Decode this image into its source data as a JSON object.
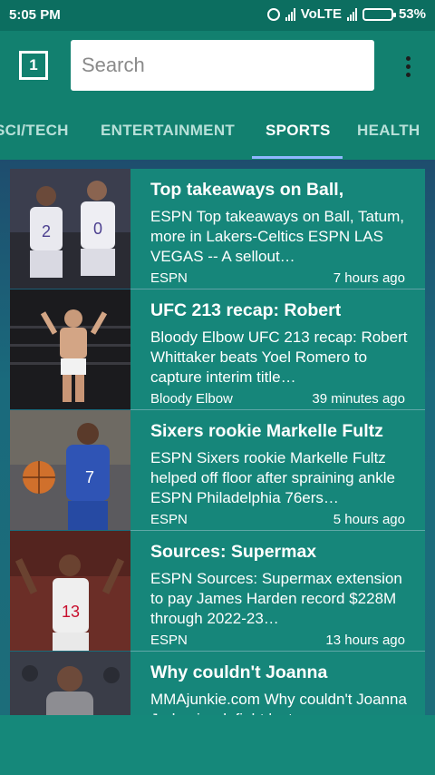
{
  "status_bar": {
    "time": "5:05 PM",
    "network": "VoLTE",
    "battery_percent": "53%",
    "battery_level": 0.53
  },
  "toolbar": {
    "tab_count": "1",
    "search_placeholder": "Search"
  },
  "tabs": [
    {
      "label": "SCI/TECH",
      "active": false
    },
    {
      "label": "ENTERTAINMENT",
      "active": false
    },
    {
      "label": "SPORTS",
      "active": true
    },
    {
      "label": "HEALTH",
      "active": false
    }
  ],
  "articles": [
    {
      "title": "Top takeaways on Ball,",
      "snippet": "ESPN Top takeaways on Ball, Tatum, more in Lakers-Celtics ESPN LAS VEGAS -- A sellout…",
      "source": "ESPN",
      "time": "7 hours ago"
    },
    {
      "title": "UFC 213 recap: Robert",
      "snippet": "Bloody Elbow UFC 213 recap: Robert Whittaker beats Yoel Romero to capture interim title…",
      "source": "Bloody Elbow",
      "time": "39 minutes ago"
    },
    {
      "title": "Sixers rookie Markelle Fultz",
      "snippet": "ESPN Sixers rookie Markelle Fultz helped off floor after spraining ankle ESPN Philadelphia 76ers…",
      "source": "ESPN",
      "time": "5 hours ago"
    },
    {
      "title": "Sources: Supermax",
      "snippet": "ESPN Sources: Supermax extension to pay James Harden record $228M through 2022-23…",
      "source": "ESPN",
      "time": "13 hours ago"
    },
    {
      "title": "Why couldn't Joanna",
      "snippet": "MMAjunkie.com Why couldn't Joanna Jedrzejczyk fight last…",
      "source": "",
      "time": ""
    }
  ]
}
